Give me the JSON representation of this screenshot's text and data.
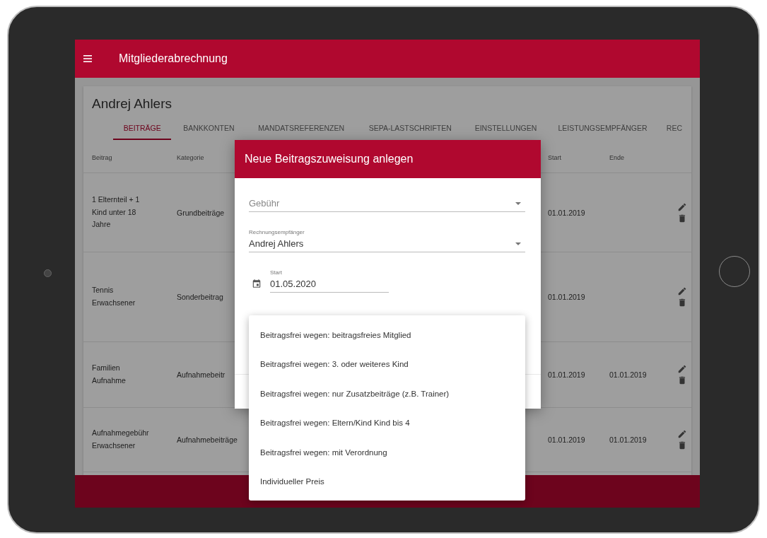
{
  "app_bar": {
    "title": "Mitgliederabrechnung"
  },
  "member": {
    "name": "Andrej Ahlers"
  },
  "tabs": [
    {
      "label": "BEITRÄGE",
      "selected": true
    },
    {
      "label": "BANKKONTEN",
      "selected": false
    },
    {
      "label": "MANDATSREFERENZEN",
      "selected": false
    },
    {
      "label": "SEPA-LASTSCHRIFTEN",
      "selected": false
    },
    {
      "label": "EINSTELLUNGEN",
      "selected": false
    },
    {
      "label": "LEISTUNGSEMPFÄNGER",
      "selected": false
    },
    {
      "label": "REC",
      "selected": false
    }
  ],
  "table": {
    "columns": [
      "Beitrag",
      "Kategorie",
      "Start",
      "Ende"
    ],
    "rows": [
      {
        "beitrag": "1 Elternteil + 1 Kind unter 18 Jahre",
        "kategorie": "Grundbeiträge",
        "start": "01.01.2019"
      },
      {
        "beitrag": "Tennis Erwachsener",
        "kategorie": "Sonderbeitrag",
        "start": "01.01.2019"
      },
      {
        "beitrag": "Familien Aufnahme",
        "kategorie": "Aufnahmebeitr",
        "start": "01.01.2019",
        "ende": "01.01.2019"
      },
      {
        "beitrag": "Aufnahmegebühr Erwachsener",
        "kategorie": "Aufnahmebeiträge",
        "start": "01.01.2019",
        "ende": "01.01.2019"
      }
    ]
  },
  "dialog": {
    "title": "Neue Beitragszuweisung anlegen",
    "fields": [
      {
        "kind": "select",
        "placeholder": "Gebühr"
      },
      {
        "kind": "select",
        "label": "Rechnungsempfänger",
        "value": "Andrej Ahlers"
      },
      {
        "kind": "date",
        "label": "Start",
        "value": "01.05.2020"
      }
    ]
  },
  "menu": {
    "options": [
      "Beitragsfrei wegen: beitragsfreies Mitglied",
      "Beitragsfrei wegen: 3. oder weiteres Kind",
      "Beitragsfrei wegen: nur Zusatzbeiträge (z.B. Trainer)",
      "Beitragsfrei wegen: Eltern/Kind Kind bis 4",
      "Beitragsfrei wegen: mit Verordnung",
      "Individueller Preis"
    ]
  }
}
